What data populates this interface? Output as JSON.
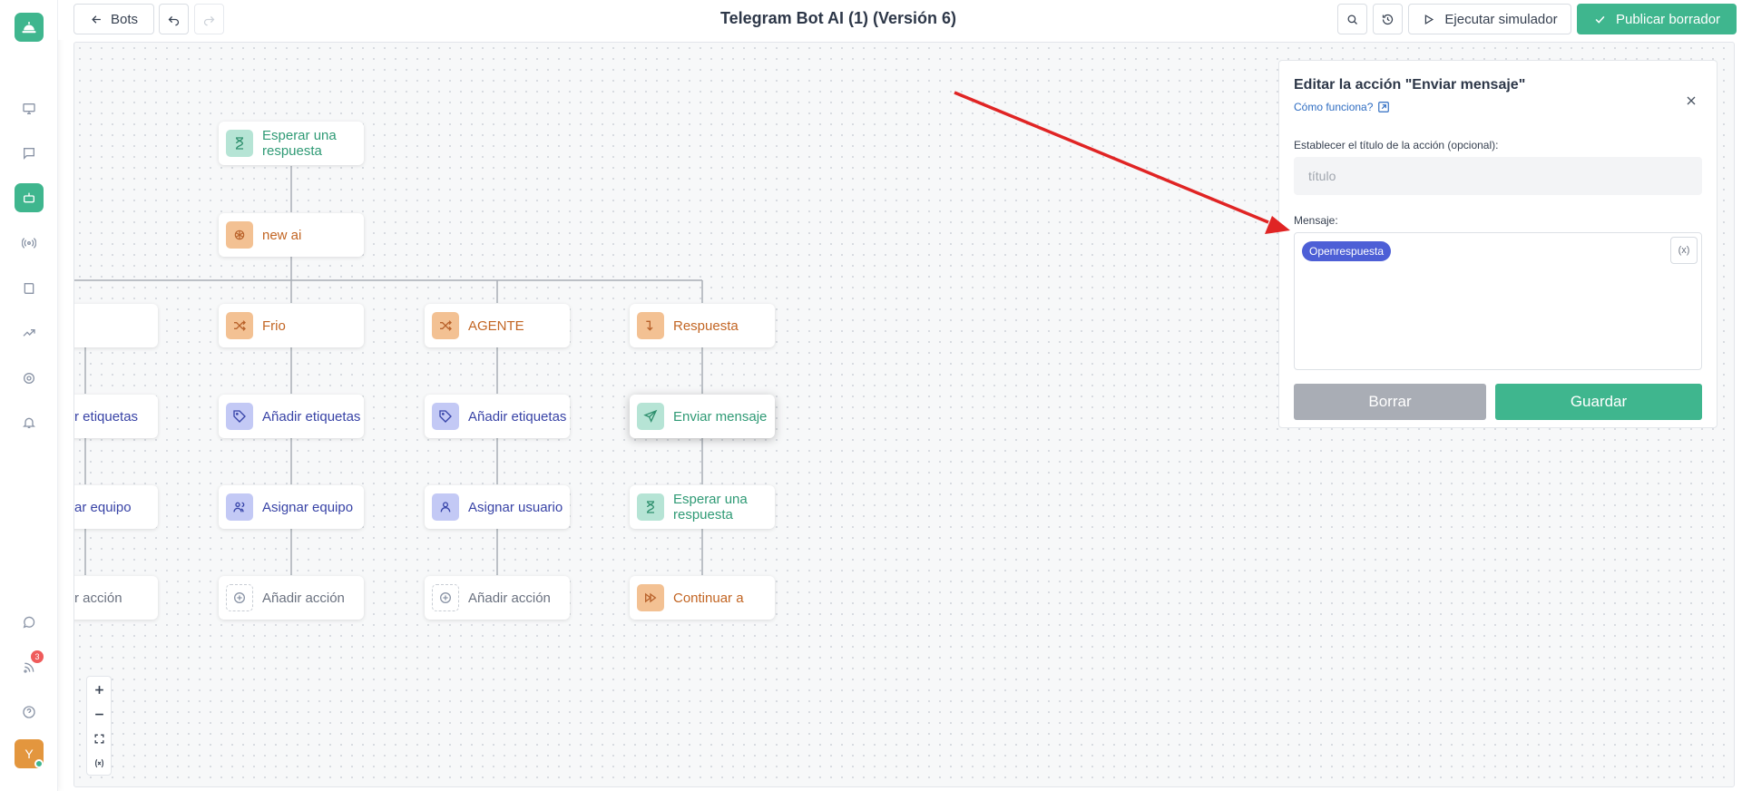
{
  "nav": {
    "badge_count": "3",
    "avatar_initial": "Y"
  },
  "toolbar": {
    "back_label": "Bots",
    "title": "Telegram Bot AI (1) (Versión 6)",
    "simulate_label": "Ejecutar simulador",
    "publish_label": "Publicar borrador"
  },
  "flow": {
    "wait_top": "Esperar una respuesta",
    "new_ai": "new ai",
    "col1": {
      "branch": "io",
      "tags": "adir etiquetas",
      "team": "ignar equipo",
      "add": "adir acción"
    },
    "col2": {
      "branch": "Frio",
      "tags": "Añadir etiquetas",
      "team": "Asignar equipo",
      "add": "Añadir acción"
    },
    "col3": {
      "branch": "AGENTE",
      "tags": "Añadir etiquetas",
      "user": "Asignar usuario",
      "add": "Añadir acción"
    },
    "col4": {
      "branch": "Respuesta",
      "send": "Enviar mensaje",
      "wait": "Esperar una respuesta",
      "continue": "Continuar a"
    }
  },
  "panel": {
    "title": "Editar la acción \"Enviar mensaje\"",
    "how_link": "Cómo funciona?",
    "title_label": "Establecer el título de la acción (opcional):",
    "title_placeholder": "título",
    "message_label": "Mensaje:",
    "message_chip": "Openrespuesta",
    "var_button": "(x)",
    "delete_label": "Borrar",
    "save_label": "Guardar"
  },
  "colors": {
    "brand": "#3fb68e",
    "chip": "#4d5fd6",
    "annotation_arrow": "#e02424"
  }
}
